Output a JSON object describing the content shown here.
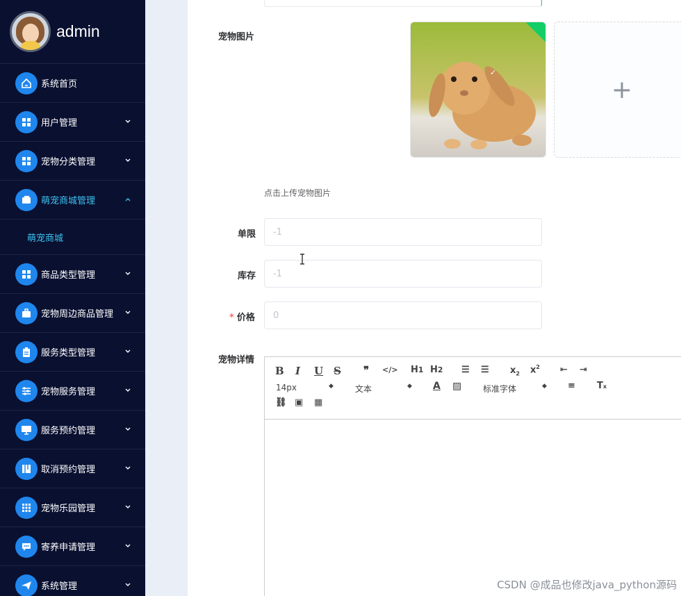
{
  "user": {
    "name": "admin"
  },
  "sidebar": {
    "items": [
      {
        "label": "系统首页",
        "icon": "home-icon",
        "hasChevron": false
      },
      {
        "label": "用户管理",
        "icon": "grid-icon",
        "hasChevron": true
      },
      {
        "label": "宠物分类管理",
        "icon": "grid-icon",
        "hasChevron": true
      },
      {
        "label": "萌宠商城管理",
        "icon": "wallet-icon",
        "hasChevron": true,
        "active": true
      },
      {
        "label": "商品类型管理",
        "icon": "grid-icon",
        "hasChevron": true
      },
      {
        "label": "宠物周边商品管理",
        "icon": "briefcase-icon",
        "hasChevron": true
      },
      {
        "label": "服务类型管理",
        "icon": "clipboard-icon",
        "hasChevron": true
      },
      {
        "label": "宠物服务管理",
        "icon": "sliders-icon",
        "hasChevron": true
      },
      {
        "label": "服务预约管理",
        "icon": "monitor-icon",
        "hasChevron": true
      },
      {
        "label": "取消预约管理",
        "icon": "book-icon",
        "hasChevron": true
      },
      {
        "label": "宠物乐园管理",
        "icon": "apps-icon",
        "hasChevron": true
      },
      {
        "label": "寄养申请管理",
        "icon": "chat-icon",
        "hasChevron": true
      },
      {
        "label": "系统管理",
        "icon": "send-icon",
        "hasChevron": true
      }
    ],
    "submenu": {
      "label": "萌宠商城"
    }
  },
  "form": {
    "image_label": "宠物图片",
    "upload_tip": "点击上传宠物图片",
    "limit_label": "单限",
    "limit_value": "-1",
    "stock_label": "库存",
    "stock_value": "-1",
    "price_label": "价格",
    "price_value": "0",
    "details_label": "宠物详情"
  },
  "editor": {
    "font_size": "14px",
    "header_select": "文本",
    "font_family": "标准字体"
  },
  "watermark": "CSDN @成品也修改java_python源码",
  "colors": {
    "sidebar_bg": "#0a1030",
    "accent": "#1f86ee",
    "active_text": "#3cc2f0",
    "success": "#13ce66"
  }
}
